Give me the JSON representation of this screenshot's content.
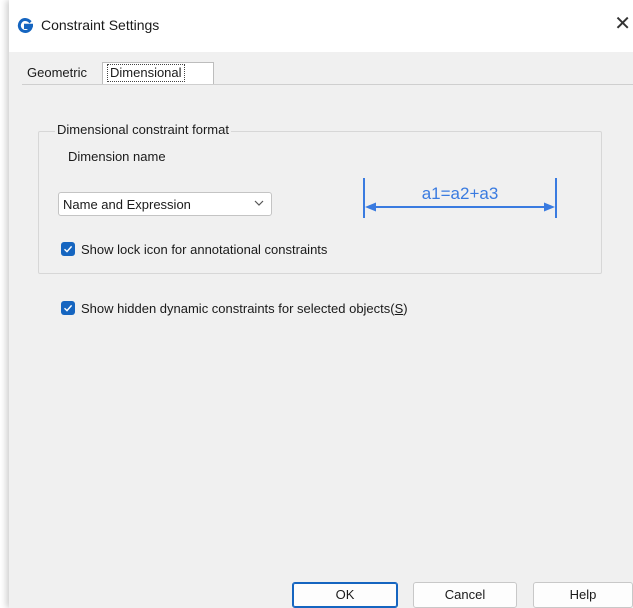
{
  "window": {
    "title": "Constraint Settings",
    "close_glyph": "✕",
    "accent_color": "#1565c0"
  },
  "tabs": [
    {
      "label": "Geometric",
      "selected": false
    },
    {
      "label": "Dimensional",
      "selected": true
    }
  ],
  "dimensional": {
    "group_title": "Dimensional constraint format",
    "dimension_name_label": "Dimension name",
    "dimension_name_select": {
      "value": "Name and Expression"
    },
    "preview_text": "a1=a2+a3",
    "show_lock_icon": {
      "label": "Show lock icon for annotational constraints",
      "checked": true
    },
    "show_hidden": {
      "label_prefix": "Show hidden dynamic constraints for selected objects(",
      "label_mnemonic": "S",
      "label_suffix": ")",
      "checked": true
    }
  },
  "buttons": {
    "ok": "OK",
    "cancel": "Cancel",
    "help": "Help"
  },
  "icons": {
    "app": "gstarcad-g-icon",
    "chevron": "chevron-down-icon",
    "check": "checkmark-icon"
  }
}
